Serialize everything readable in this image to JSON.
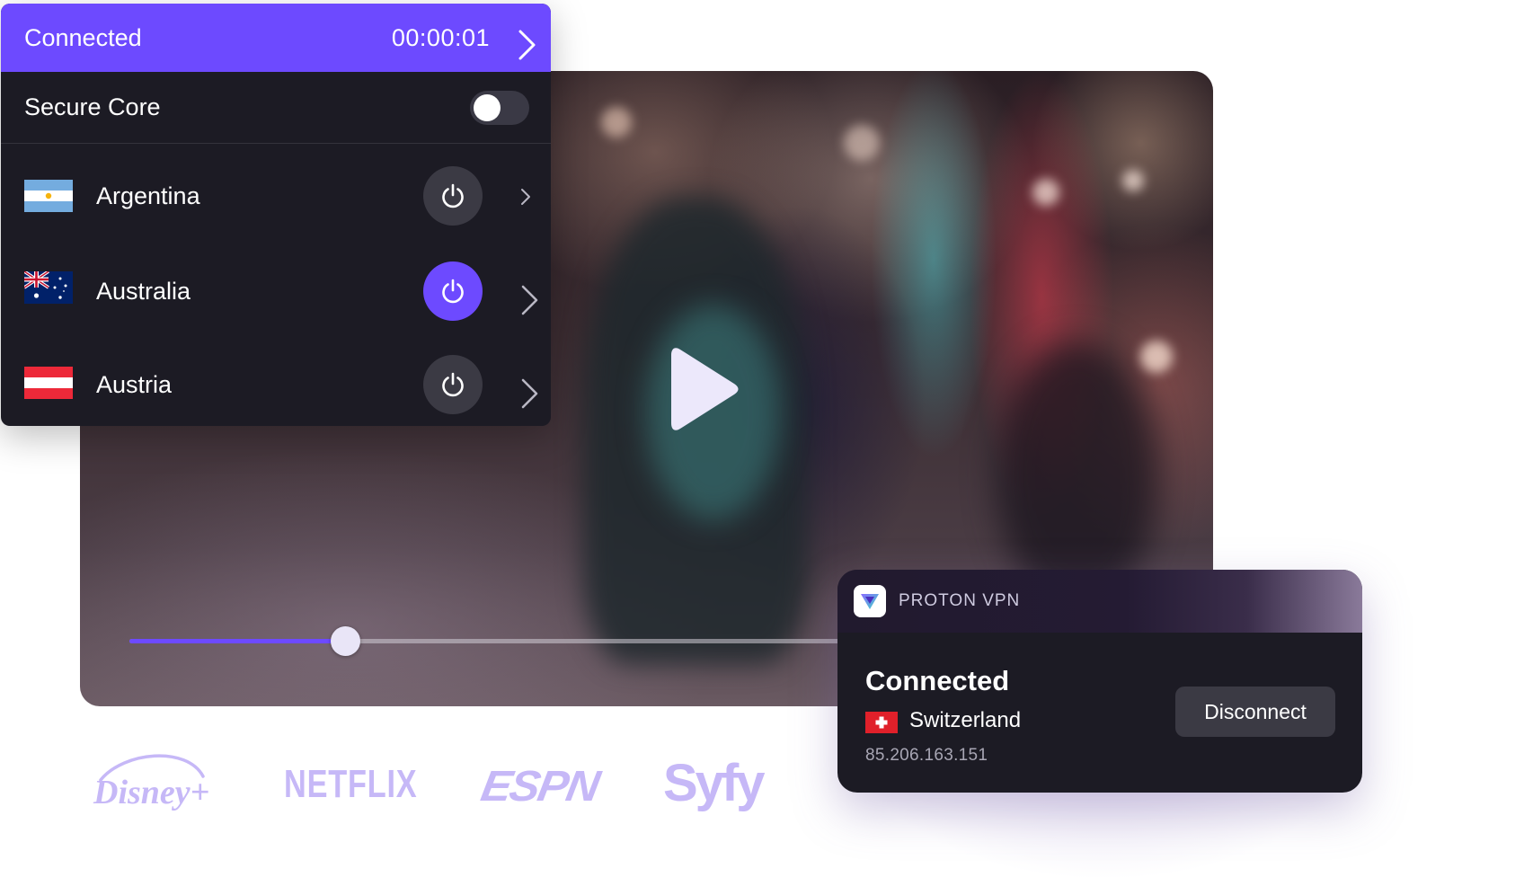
{
  "panel": {
    "status": "Connected",
    "timer": "00:00:01",
    "secure_core_label": "Secure Core",
    "secure_core_enabled": false,
    "countries": [
      {
        "name": "Argentina",
        "flag": "argentina-flag",
        "connected": false
      },
      {
        "name": "Australia",
        "flag": "australia-flag",
        "connected": true
      },
      {
        "name": "Austria",
        "flag": "austria-flag",
        "connected": false
      }
    ]
  },
  "player": {
    "play_icon": "play-icon",
    "progress": 0.3
  },
  "brands": [
    "Disney+",
    "NETFLIX",
    "ESPN",
    "Syfy"
  ],
  "vpn_card": {
    "app_name": "PROTON VPN",
    "status": "Connected",
    "country": "Switzerland",
    "ip": "85.206.163.151",
    "disconnect_label": "Disconnect"
  },
  "colors": {
    "accent": "#6d4aff",
    "panel_bg": "#1c1b24",
    "logo_tint": "#c6b8f7"
  }
}
